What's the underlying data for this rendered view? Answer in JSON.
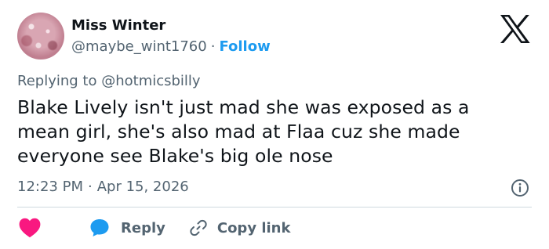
{
  "tweet": {
    "author": {
      "display_name": "Miss Winter",
      "handle": "@maybe_wint1760",
      "separator": "·",
      "follow_label": "Follow",
      "avatar_icon": "avatar"
    },
    "brand_icon": "x-logo-icon",
    "replying_prefix": "Replying to",
    "replying_to": "@hotmicsbilly",
    "body_lines": [
      "Blake Lively isn't just mad she was exposed as a",
      "mean girl, she's also mad at Flaa cuz she made",
      "everyone see Blake's big ole nose"
    ],
    "time": "12:23 PM",
    "date_separator": "·",
    "date": "Apr 15, 2026",
    "info_icon": "info-icon",
    "actions": {
      "like_icon": "heart-icon",
      "reply_icon": "reply-bubble-icon",
      "reply_label": "Reply",
      "copy_icon": "link-icon",
      "copy_label": "Copy link"
    }
  },
  "colors": {
    "accent": "#1d9bf0",
    "heart": "#f91880",
    "muted": "#536471",
    "text": "#0f1419",
    "divider": "#cfd9de"
  }
}
